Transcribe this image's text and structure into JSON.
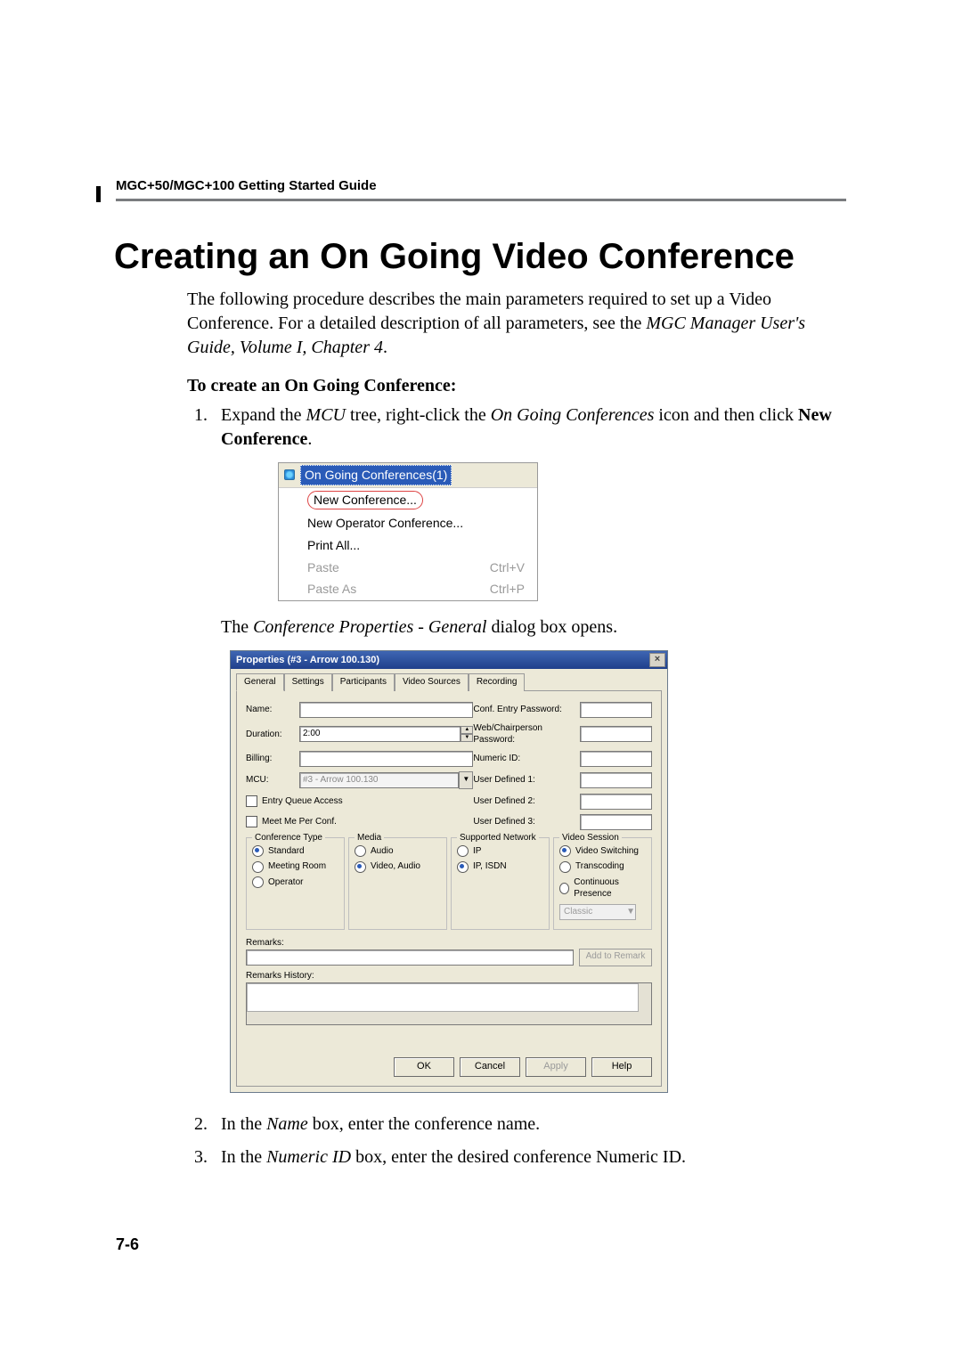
{
  "header": "MGC+50/MGC+100 Getting Started Guide",
  "title": "Creating an On Going Video Conference",
  "intro": {
    "l1": "The following procedure describes the main parameters required to set up a",
    "l2a": "Video Conference. For a detailed description of all parameters, see the ",
    "l2b": "MGC Manager User's Guide, Volume I, Chapter 4",
    "l2c": "."
  },
  "subhead": "To create an On Going Conference:",
  "step1": {
    "a": "Expand the ",
    "b": "MCU",
    "c": " tree, right-click the ",
    "d": "On Going Conferences",
    "e": " icon and then click ",
    "f": "New Conference",
    "g": "."
  },
  "ctx": {
    "title": "On Going Conferences(1)",
    "items": [
      {
        "label": "New Conference...",
        "shortcut": "",
        "disabled": false,
        "highlight": true
      },
      {
        "label": "New Operator Conference...",
        "shortcut": "",
        "disabled": false
      },
      {
        "label": "Print All...",
        "shortcut": "",
        "disabled": false
      },
      {
        "label": "Paste",
        "shortcut": "Ctrl+V",
        "disabled": true
      },
      {
        "label": "Paste As",
        "shortcut": "Ctrl+P",
        "disabled": true
      }
    ]
  },
  "caption1": {
    "a": "The ",
    "b": "Conference Properties - General",
    "c": " dialog box opens."
  },
  "dialog": {
    "title": "Properties (#3 - Arrow 100.130)",
    "close": "×",
    "tabs": [
      "General",
      "Settings",
      "Participants",
      "Video Sources",
      "Recording"
    ],
    "fields": {
      "name_lbl": "Name:",
      "name_val": "",
      "duration_lbl": "Duration:",
      "duration_val": "2:00",
      "billing_lbl": "Billing:",
      "billing_val": "",
      "mcu_lbl": "MCU:",
      "mcu_val": "#3 - Arrow 100.130",
      "entry_queue": "Entry Queue Access",
      "meet_me": "Meet Me Per Conf.",
      "conf_entry_lbl": "Conf. Entry Password:",
      "conf_entry_val": "",
      "web_lbl": "Web/Chairperson Password:",
      "web_val": "",
      "numeric_lbl": "Numeric ID:",
      "numeric_val": "",
      "ud1_lbl": "User Defined 1:",
      "ud2_lbl": "User Defined 2:",
      "ud3_lbl": "User Defined 3:"
    },
    "groups": {
      "conf_type": {
        "title": "Conference Type",
        "options": [
          "Standard",
          "Meeting Room",
          "Operator"
        ],
        "selected": 0
      },
      "media": {
        "title": "Media",
        "options": [
          "Audio",
          "Video, Audio"
        ],
        "selected": 1
      },
      "network": {
        "title": "Supported Network",
        "options": [
          "IP",
          "IP, ISDN"
        ],
        "selected": 1
      },
      "video_session": {
        "title": "Video Session",
        "options": [
          "Video Switching",
          "Transcoding",
          "Continuous Presence"
        ],
        "selected": 0,
        "classic": "Classic"
      }
    },
    "remarks_lbl": "Remarks:",
    "add_remark": "Add to Remark",
    "history_lbl": "Remarks History:",
    "buttons": {
      "ok": "OK",
      "cancel": "Cancel",
      "apply": "Apply",
      "help": "Help"
    }
  },
  "step2": {
    "a": "In the ",
    "b": "Name",
    "c": " box, enter the conference name."
  },
  "step3": {
    "a": "In the ",
    "b": "Numeric ID",
    "c": " box, enter the desired conference Numeric ID."
  },
  "page_number": "7-6"
}
